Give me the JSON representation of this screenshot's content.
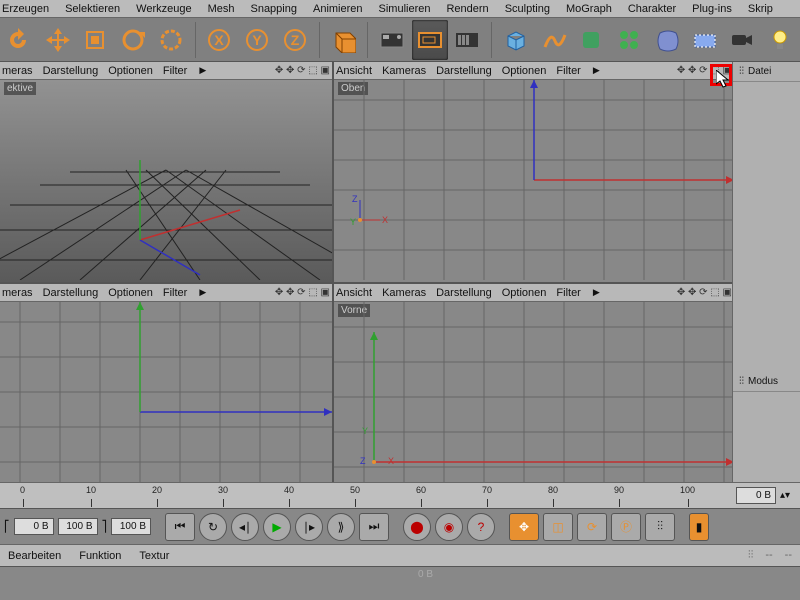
{
  "menu": [
    "Erzeugen",
    "Selektieren",
    "Werkzeuge",
    "Mesh",
    "Snapping",
    "Animieren",
    "Simulieren",
    "Rendern",
    "Sculpting",
    "MoGraph",
    "Charakter",
    "Plug-ins",
    "Skrip"
  ],
  "viewport_menu": [
    "Ansicht",
    "Kameras",
    "Darstellung",
    "Optionen",
    "Filter"
  ],
  "viewport_menu_short": [
    "meras",
    "Darstellung",
    "Optionen",
    "Filter"
  ],
  "right_tabs": {
    "datei": "Datei",
    "modus": "Modus"
  },
  "vplabels": {
    "tl": "ektive",
    "tr": "Oben",
    "br": "Vorne"
  },
  "timeline": {
    "ticks": [
      "50",
      "80",
      "110",
      "140",
      "170",
      "200",
      "260",
      "320",
      "380",
      "440",
      "500",
      "560",
      "620",
      "680"
    ],
    "ticklabels": [
      "0",
      "10",
      "20",
      "30",
      "40",
      "50",
      "60",
      "70",
      "80",
      "90",
      "100"
    ],
    "field": "0 B"
  },
  "transport": {
    "rangeA": "0 B",
    "rangeB": "100 B",
    "cur": "100 B"
  },
  "bottom": [
    "Bearbeiten",
    "Funktion",
    "Textur"
  ],
  "attrs": {
    "dash": "--",
    "zero": "0 B"
  }
}
